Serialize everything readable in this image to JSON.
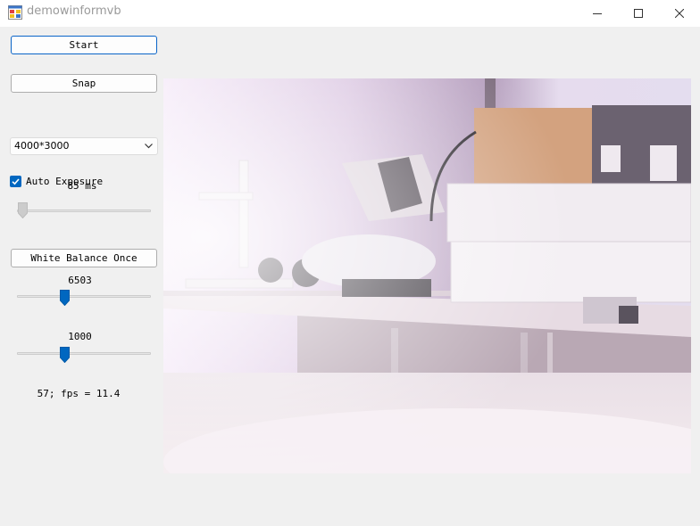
{
  "window": {
    "title": "demowinformvb",
    "icons": [
      "app-icon",
      "minimize-icon",
      "maximize-icon",
      "close-icon"
    ]
  },
  "controls": {
    "start_label": "Start",
    "snap_label": "Snap",
    "resolution": {
      "selected": "4000*3000",
      "icon": "chevron-down-icon"
    },
    "auto_exposure": {
      "label": "Auto Exposure",
      "checked": true,
      "icon": "checkmark-icon"
    },
    "exposure": {
      "value_label": "85 ms",
      "slider_fraction": 0.04
    },
    "white_balance_once_label": "White Balance Once",
    "temperature": {
      "value_label": "6503",
      "slider_fraction": 0.36
    },
    "tint": {
      "value_label": "1000",
      "slider_fraction": 0.36
    },
    "status": "57; fps = 11.4"
  },
  "colors": {
    "accent": "#0067c0",
    "focus_border": "#0a64c8",
    "window_bg": "#f0f0f0",
    "titlebar_bg": "#ffffff"
  },
  "preview": {
    "description_icon": "camera-preview-image"
  }
}
